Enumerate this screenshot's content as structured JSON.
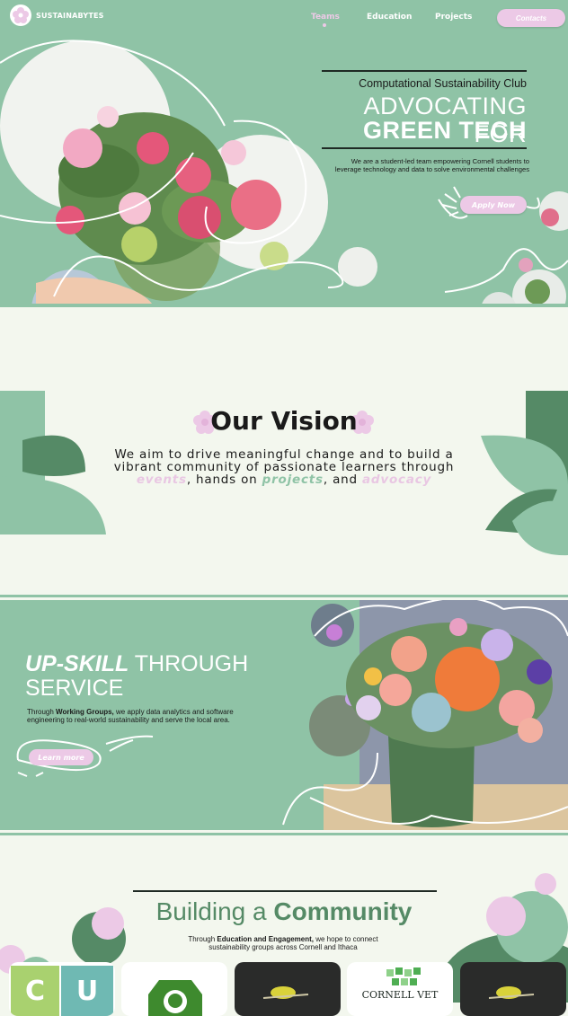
{
  "header": {
    "brand": "SUSTAINABYTES",
    "nav": [
      {
        "label": "Teams",
        "active": true
      },
      {
        "label": "Education",
        "active": false
      },
      {
        "label": "Projects",
        "active": false
      }
    ],
    "contacts_label": "Contacts"
  },
  "hero": {
    "kicker": "Computational Sustainability Club",
    "title_line1": "ADVOCATING FOR",
    "title_line2": "GREEN TECH",
    "description": "We are a student-led team empowering Cornell students to leverage technology and data to solve environmental challenges",
    "apply_label": "Apply Now"
  },
  "vision": {
    "title": "Our Vision",
    "text_before": "We aim to drive meaningful change and to build a vibrant community of passionate learners through ",
    "em1": "events",
    "text_mid1": ", hands on ",
    "em2": "projects",
    "text_mid2": ", and ",
    "em3": "advocacy"
  },
  "upskill": {
    "title_em": "UP-SKILL",
    "title_rest": " THROUGH",
    "title_line2": "SERVICE",
    "desc_before": "Through ",
    "desc_bold": "Working Groups,",
    "desc_after": " we apply data analytics and software engineering to real-world sustainability and serve the local area.",
    "learn_label": "Learn more"
  },
  "community": {
    "title_plain": "Building a ",
    "title_bold": "Community",
    "desc_before": "Through ",
    "desc_bold": "Education and Engagement,",
    "desc_after": " we hope to connect sustainability groups across Cornell and Ithaca",
    "cards": [
      {
        "letters": [
          "C",
          "U"
        ]
      },
      {
        "label": ""
      },
      {
        "label": ""
      },
      {
        "label": "CORNELL VET"
      },
      {
        "label": ""
      }
    ]
  },
  "colors": {
    "sage": "#8fc3a6",
    "dark_green": "#558a66",
    "pink": "#ecc9e6",
    "cream": "#f3f7ee"
  }
}
